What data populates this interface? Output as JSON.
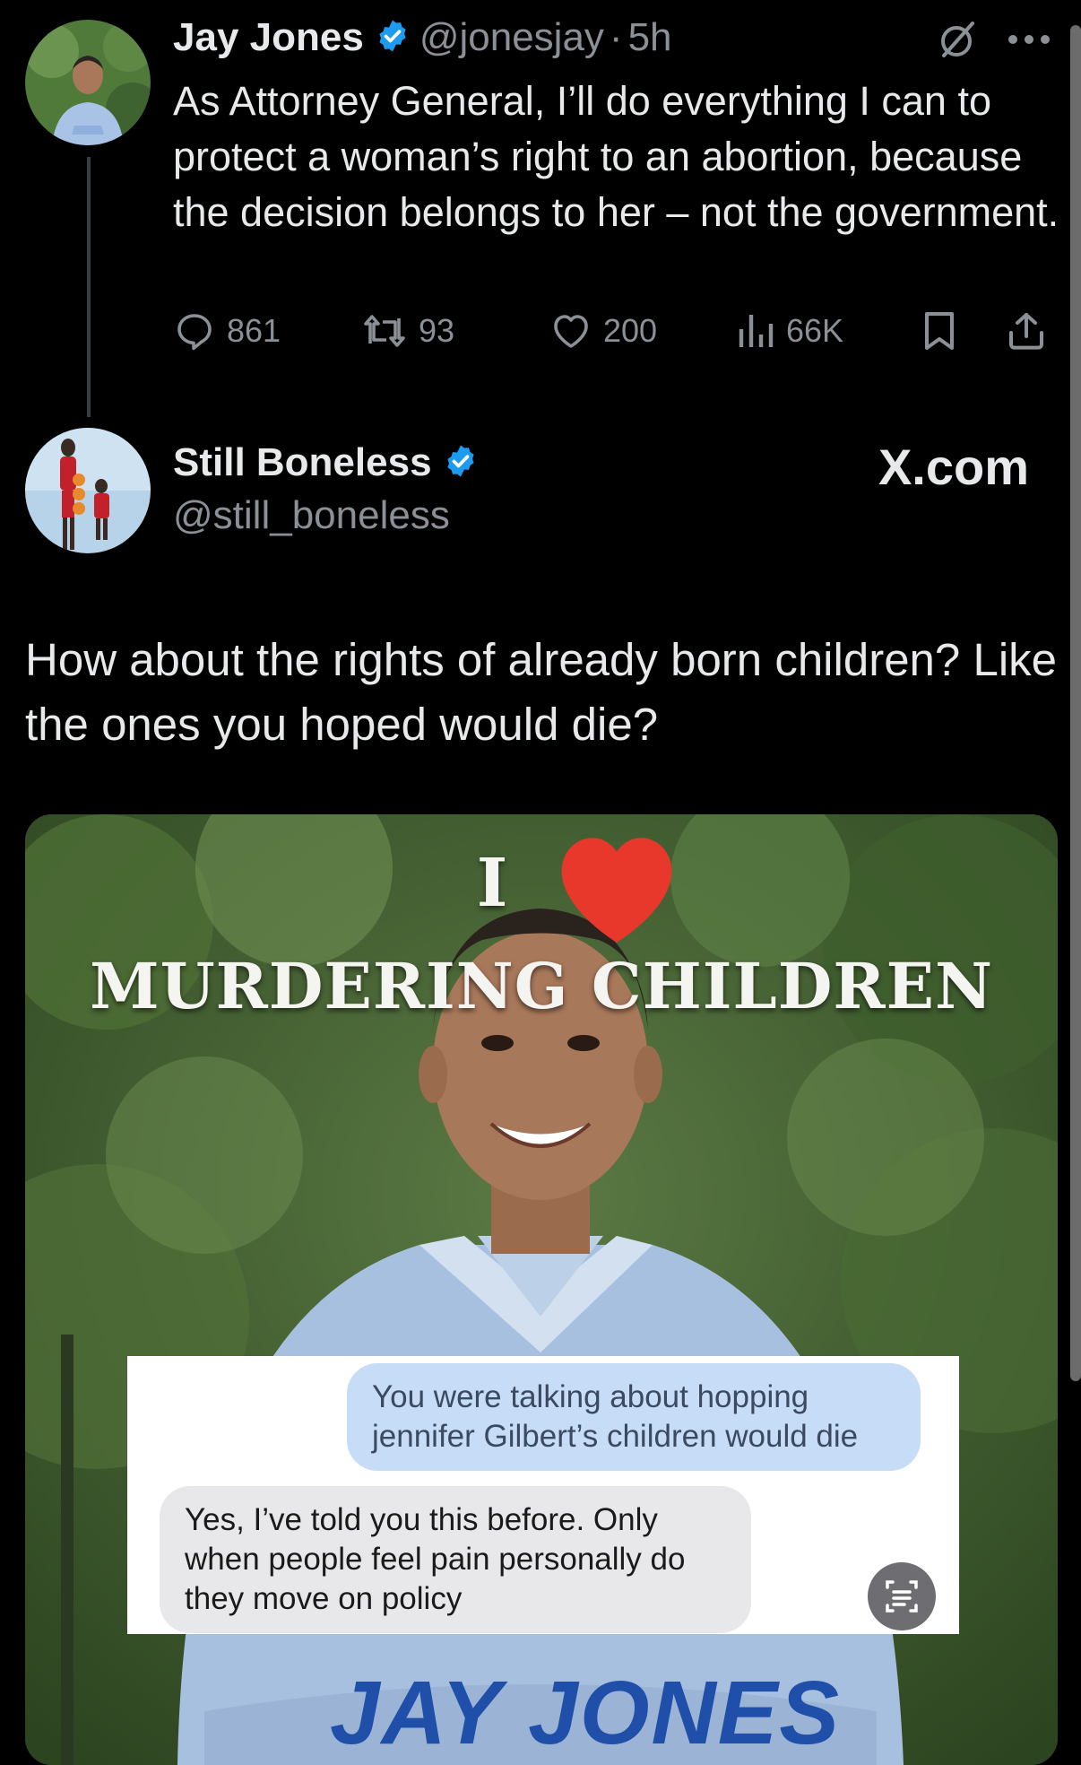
{
  "original_tweet": {
    "author_name": "Jay Jones",
    "handle": "@jonesjay",
    "separator": "·",
    "time": "5h",
    "text": "As Attorney General, I’ll do everything I can to protect a woman’s right to an abortion, because the decision belongs to her – not the government.",
    "stats": {
      "replies": "861",
      "reposts": "93",
      "likes": "200",
      "views": "66K"
    }
  },
  "reply_tweet": {
    "author_name": "Still Boneless",
    "handle": "@still_boneless",
    "watermark": "X.com",
    "text": "How about the rights of already born children? Like the ones you hoped would die?",
    "media": {
      "meme_line1": "I",
      "meme_line2": "MURDERING CHILDREN",
      "chat_blue": "You were talking about hopping jennifer Gilbert’s children would die",
      "chat_gray": "Yes, I’ve told you this before. Only when people feel pain personally do they move on policy",
      "logo_text": "JAY JONES"
    }
  },
  "colors": {
    "background": "#000000",
    "verified": "#1d9bf0",
    "muted": "#8b9097",
    "heart": "#e8382b"
  },
  "icons": [
    "verified-badge-icon",
    "grok-icon",
    "more-icon",
    "reply-icon",
    "repost-icon",
    "like-icon",
    "views-icon",
    "bookmark-icon",
    "share-icon",
    "heart-icon",
    "live-text-icon"
  ]
}
